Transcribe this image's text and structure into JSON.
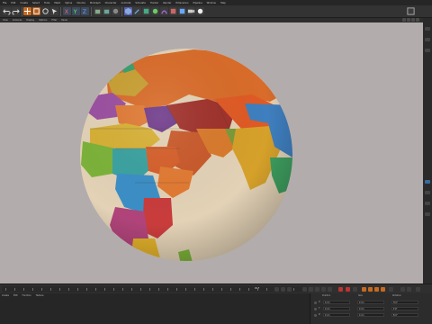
{
  "menubar": {
    "items": [
      "File",
      "Edit",
      "Create",
      "Select",
      "Tools",
      "Mesh",
      "Spline",
      "Volume",
      "MoGraph",
      "Character",
      "Animate",
      "Simulate",
      "Tracker",
      "Render",
      "Extensions",
      "Pipeline",
      "Window",
      "Help"
    ]
  },
  "viewmenu": {
    "items": [
      "View",
      "Cameras",
      "Display",
      "Options",
      "Filter",
      "Panel"
    ]
  },
  "timeline": {
    "frame_readout": "90 F"
  },
  "material_panel": {
    "tabs": [
      "Create",
      "Edit",
      "Function",
      "Texture"
    ]
  },
  "coordinates": {
    "headers": [
      "Position",
      "Size",
      "Rotation"
    ],
    "rows": [
      {
        "label": "X",
        "position": "0 cm",
        "size": "0 cm",
        "rotation": "H 0°"
      },
      {
        "label": "Y",
        "position": "0 cm",
        "size": "0 cm",
        "rotation": "P 0°"
      },
      {
        "label": "Z",
        "position": "0 cm",
        "size": "0 cm",
        "rotation": "B 0°"
      }
    ]
  },
  "colors": {
    "accent": "#c86a1e",
    "viewport_bg": "#b3acac",
    "ocean": "#e2cfb2"
  },
  "icons": [
    "undo-icon",
    "redo-icon",
    "move-icon",
    "scale-icon",
    "rotate-icon",
    "render-icon",
    "cube-icon",
    "pen-icon",
    "light-icon",
    "camera-icon"
  ]
}
